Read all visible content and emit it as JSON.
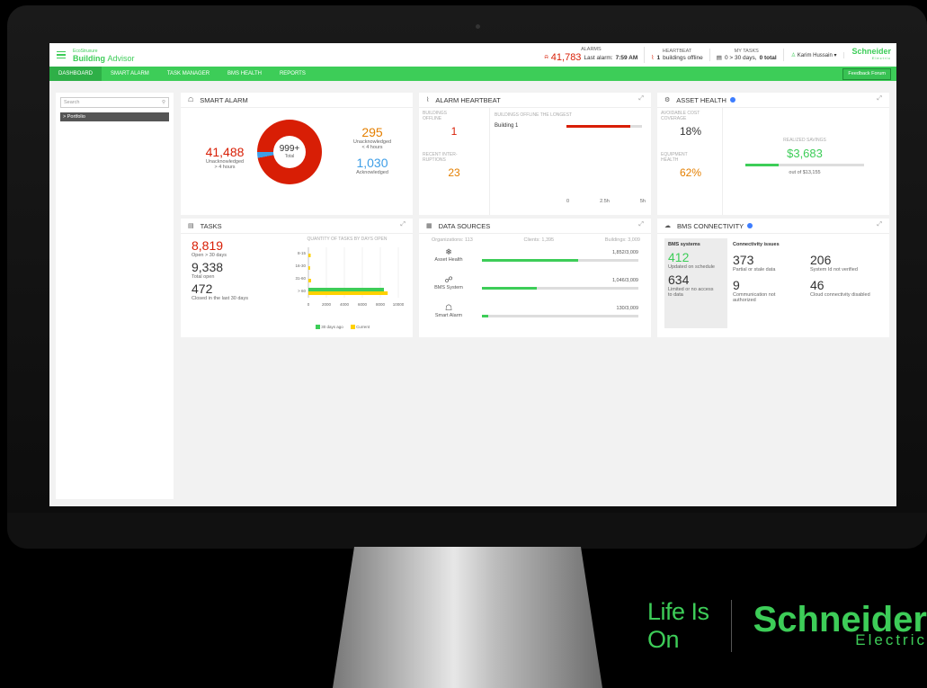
{
  "topbar": {
    "logo_small": "EcoStruxure",
    "logo_title_bold": "Building",
    "logo_title_rest": "Advisor",
    "alarms_head": "ALARMS",
    "alarms_count": "41,783",
    "alarms_last": "Last alarm:",
    "alarms_time": "7:59 AM",
    "heartbeat_head": "HEARTBEAT",
    "heartbeat_value": "1",
    "heartbeat_text": "buildings offline",
    "tasks_head": "MY TASKS",
    "tasks_text": "0 > 30 days,",
    "tasks_total": "0 total",
    "user": "Karim Hussain",
    "brand": "Schneider",
    "brand_sub": "Electric"
  },
  "nav": [
    "DASHBOARD",
    "SMART ALARM",
    "TASK MANAGER",
    "BMS HEALTH",
    "REPORTS"
  ],
  "feedback": "Feedback Forum",
  "sidebar": {
    "search_placeholder": "Search",
    "portfolio": "> Portfolio"
  },
  "smart_alarm": {
    "title": "SMART ALARM",
    "red_value": "41,488",
    "red_label_1": "Unacknowledged",
    "red_label_2": "> 4 hours",
    "center_value": "999+",
    "center_label": "Total",
    "orange_value": "295",
    "orange_label_1": "Unacknowledged",
    "orange_label_2": "< 4 hours",
    "blue_value": "1,030",
    "blue_label": "Acknowledged"
  },
  "heartbeat": {
    "title": "ALARM HEARTBEAT",
    "buildings_offline_1": "BUILDINGS",
    "buildings_offline_2": "OFFLINE",
    "buildings_offline_value": "1",
    "recent_1": "RECENT INTER-",
    "recent_2": "RUPTIONS",
    "recent_value": "23",
    "longest_title": "BUILDINGS OFFLINE THE LONGEST",
    "building_name": "Building 1",
    "axis": [
      "0",
      "2.5h",
      "5h"
    ],
    "offline_fraction": 0.85
  },
  "asset_health": {
    "title": "ASSET HEALTH",
    "avoidable_1": "AVOIDABLE COST",
    "avoidable_2": "COVERAGE",
    "avoidable_value": "18%",
    "equipment_1": "EQUIPMENT",
    "equipment_2": "HEALTH",
    "equipment_value": "62%",
    "savings_label": "REALIZED SAVINGS",
    "savings_value": "$3,683",
    "savings_of": "out of $13,155",
    "savings_fraction": 0.28
  },
  "tasks": {
    "title": "TASKS",
    "open_value": "8,819",
    "open_label": "Open > 30 days",
    "total_value": "9,338",
    "total_label": "Total open",
    "closed_value": "472",
    "closed_label": "Closed in the last 30 days",
    "chart_title": "QUANTITY OF TASKS BY DAYS OPEN",
    "legend_1": "30 days ago",
    "legend_2": "Current"
  },
  "chart_data": {
    "type": "bar",
    "title": "QUANTITY OF TASKS BY DAYS OPEN",
    "categories": [
      "8-15",
      "16-30",
      "31-60",
      "> 60"
    ],
    "xticks": [
      "0",
      "2000",
      "4000",
      "6000",
      "8000",
      "10000"
    ],
    "xlim": [
      0,
      10000
    ],
    "series": [
      {
        "name": "30 days ago",
        "values": [
          0,
          0,
          0,
          8400
        ],
        "color": "#3dcd58"
      },
      {
        "name": "Current",
        "values": [
          250,
          180,
          300,
          8819
        ],
        "color": "#ffd100"
      }
    ]
  },
  "data_sources": {
    "title": "DATA SOURCES",
    "orgs": "Organizations: 113",
    "clients": "Clients: 1,395",
    "buildings": "Buildings: 3,009",
    "rows": [
      {
        "label": "Asset Health",
        "count": "1,852/3,009",
        "fraction": 0.615
      },
      {
        "label": "BMS System",
        "count": "1,046/3,009",
        "fraction": 0.348
      },
      {
        "label": "Smart Alarm",
        "count": "130/3,009",
        "fraction": 0.043
      }
    ]
  },
  "bms": {
    "title": "BMS CONNECTIVITY",
    "systems_head": "BMS systems",
    "sched_value": "412",
    "sched_label": "Updated on schedule",
    "limited_value": "634",
    "limited_label_1": "Limited or no access",
    "limited_label_2": "to data",
    "issues_head": "Connectivity issues",
    "partial_value": "373",
    "partial_label": "Partial or stale data",
    "notverified_value": "206",
    "notverified_label": "System Id not verified",
    "comm_value": "9",
    "comm_label_1": "Communication not",
    "comm_label_2": "authorized",
    "cloud_value": "46",
    "cloud_label": "Cloud connectivity disabled"
  },
  "brand_footer": {
    "life_is_on": "Life Is On",
    "schneider": "Schneider",
    "electric": "Electric"
  }
}
